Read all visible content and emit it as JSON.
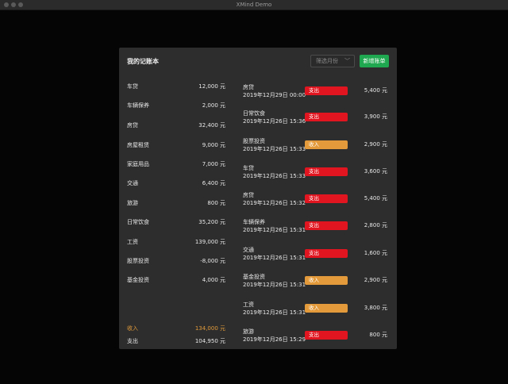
{
  "window": {
    "title": "XMind Demo"
  },
  "panel": {
    "title": "我的记账本",
    "month_placeholder": "筛选月份",
    "add_button": "新增账单"
  },
  "colors": {
    "expense": "#e0151f",
    "income": "#e39a3a",
    "add_button": "#1fa84f"
  },
  "summary": [
    {
      "name": "车贷",
      "value": "12,000 元"
    },
    {
      "name": "车辆保养",
      "value": "2,000 元"
    },
    {
      "name": "房贷",
      "value": "32,400 元"
    },
    {
      "name": "房屋租赁",
      "value": "9,000 元"
    },
    {
      "name": "家庭用品",
      "value": "7,000 元"
    },
    {
      "name": "交通",
      "value": "6,400 元"
    },
    {
      "name": "旅游",
      "value": "800 元"
    },
    {
      "name": "日常饮食",
      "value": "35,200 元"
    },
    {
      "name": "工资",
      "value": "139,000 元"
    },
    {
      "name": "股票投资",
      "value": "-8,000 元"
    },
    {
      "name": "基金投资",
      "value": "4,000 元"
    }
  ],
  "totals": {
    "income": {
      "label": "收入",
      "value": "134,000 元"
    },
    "expense": {
      "label": "支出",
      "value": "104,950 元"
    }
  },
  "records": [
    {
      "category": "房贷",
      "time": "2019年12月29日 00:00",
      "type": "支出",
      "amount": "5,400 元"
    },
    {
      "category": "日常饮食",
      "time": "2019年12月26日 15:36",
      "type": "支出",
      "amount": "3,900 元"
    },
    {
      "category": "股票投资",
      "time": "2019年12月26日 15:33",
      "type": "收入",
      "amount": "2,900 元"
    },
    {
      "category": "车贷",
      "time": "2019年12月26日 15:33",
      "type": "支出",
      "amount": "3,600 元"
    },
    {
      "category": "房贷",
      "time": "2019年12月26日 15:32",
      "type": "支出",
      "amount": "5,400 元"
    },
    {
      "category": "车辆保养",
      "time": "2019年12月26日 15:31",
      "type": "支出",
      "amount": "2,800 元"
    },
    {
      "category": "交通",
      "time": "2019年12月26日 15:31",
      "type": "支出",
      "amount": "1,600 元"
    },
    {
      "category": "基金投资",
      "time": "2019年12月26日 15:31",
      "type": "收入",
      "amount": "2,900 元"
    },
    {
      "category": "工资",
      "time": "2019年12月26日 15:31",
      "type": "收入",
      "amount": "3,800 元"
    },
    {
      "category": "旅游",
      "time": "2019年12月26日 15:29",
      "type": "支出",
      "amount": "800 元"
    }
  ]
}
